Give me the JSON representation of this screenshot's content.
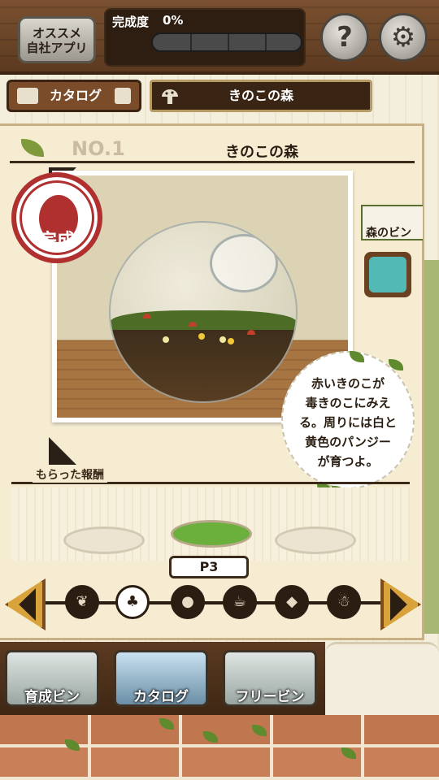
{
  "header": {
    "app_promo_label_1": "オススメ",
    "app_promo_label_2": "自社アプリ",
    "progress_label": "完成度",
    "progress_value": "0%",
    "progress_fraction": 0,
    "help_symbol": "?",
    "settings_symbol": "⚙"
  },
  "subbar": {
    "catalog_label": "カタログ",
    "current_title": "きのこの森"
  },
  "card": {
    "number": "NO.1",
    "name": "きのこの森",
    "stamp_text": "完成",
    "side_tag": "森のビン",
    "description_lines": [
      "赤いきのこが",
      "毒きのこにみえ",
      "る。周りには白と",
      "黄色のパンジー",
      "が育つよ。"
    ]
  },
  "rewards": {
    "title": "もらった報酬",
    "page": "P3"
  },
  "category_icons": [
    "leaf-icon",
    "mushroom-icon",
    "nuts-icon",
    "cake-icon",
    "cheese-icon",
    "snowman-icon"
  ],
  "category_glyphs": [
    "❦",
    "♣",
    "●",
    "☕",
    "◆",
    "☃"
  ],
  "active_category_index": 1,
  "bottom_tabs": [
    {
      "label": "育成ビン"
    },
    {
      "label": "カタログ"
    },
    {
      "label": "フリービン"
    }
  ],
  "active_tab_index": 1,
  "colors": {
    "wood_dark": "#3d2512",
    "card_bg": "#f6ecd2",
    "progress_fill": "#7bc24a",
    "stamp_red": "#b03030",
    "twitter_teal": "#53b9b5",
    "nav_gold": "#d9a23a"
  }
}
